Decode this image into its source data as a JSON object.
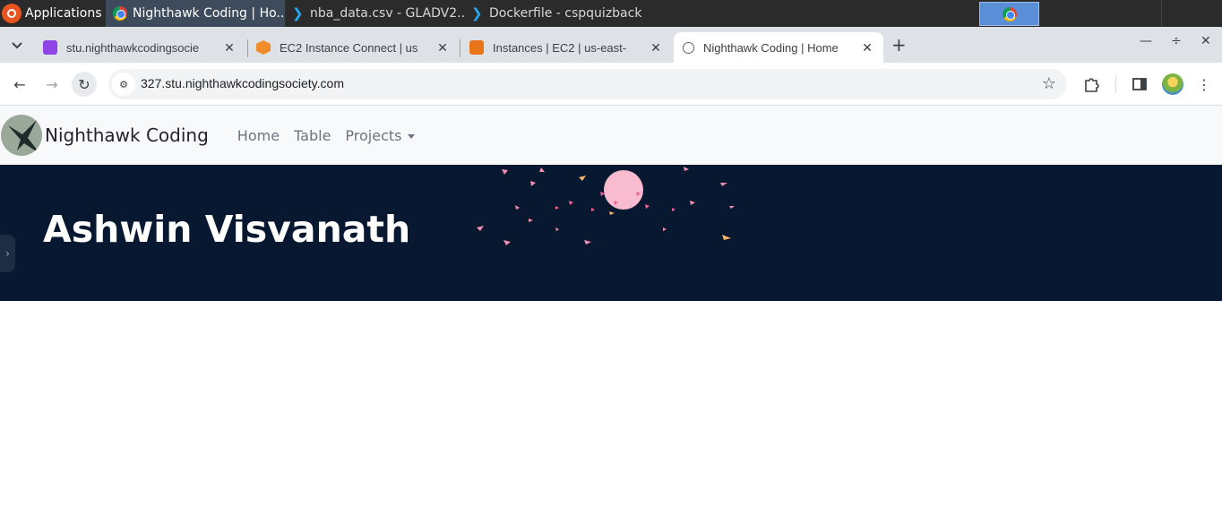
{
  "taskbar": {
    "applications_label": "Applications",
    "tasks": [
      {
        "label": "Nighthawk Coding | Ho...",
        "icon": "chrome-icon"
      },
      {
        "label": "nba_data.csv - GLADV2...",
        "icon": "vscode-icon"
      },
      {
        "label": "Dockerfile - cspquizback...",
        "icon": "vscode-icon"
      }
    ]
  },
  "browser": {
    "tabs": [
      {
        "label": "stu.nighthawkcodingsocie",
        "icon": "purple-site-icon"
      },
      {
        "label": "EC2 Instance Connect | us",
        "icon": "aws-ec2-icon"
      },
      {
        "label": "Instances | EC2 | us-east-",
        "icon": "aws-instances-icon"
      },
      {
        "label": "Nighthawk Coding | Home",
        "icon": "globe-icon"
      }
    ],
    "active_tab": 3,
    "url": "327.stu.nighthawkcodingsociety.com"
  },
  "site": {
    "brand": "Nighthawk Coding",
    "nav": [
      {
        "label": "Home"
      },
      {
        "label": "Table"
      },
      {
        "label": "Projects"
      }
    ],
    "hero_title": "Ashwin Visvanath"
  },
  "colors": {
    "hero_bg": "#081830",
    "nav_bg": "#f8f9fa",
    "taskbar_bg": "#2b2b2b",
    "tabstrip_bg": "#dee1e6",
    "confetti": "#f48fb1"
  }
}
